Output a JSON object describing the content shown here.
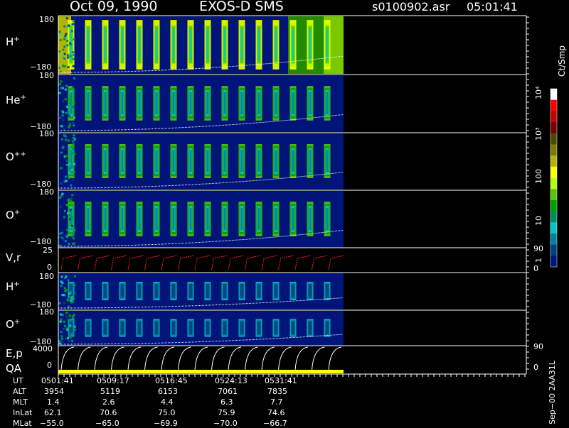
{
  "header": {
    "date": "Oct 09, 1990",
    "instrument": "EXOS-D SMS",
    "filename": "s0100902.asr",
    "time": "05:01:41"
  },
  "colorbar": {
    "unit": "Ct/Smp",
    "labels": [
      "10⁴",
      "10³",
      "100",
      "10",
      "1"
    ],
    "colors": [
      "#ffffff",
      "#ff0000",
      "#c80000",
      "#780000",
      "#4a4a00",
      "#7a7a00",
      "#b4b400",
      "#ffff00",
      "#b4ff00",
      "#5ac800",
      "#00a000",
      "#008c5a",
      "#00c8c8",
      "#0080a0",
      "#004080",
      "#00147a"
    ]
  },
  "chart_data": [
    {
      "type": "heatmap",
      "panel": "H+",
      "label": "H",
      "sup": "+",
      "ytick_top": "180",
      "ytick_bottom": "−180",
      "ylim": [
        -180,
        180
      ]
    },
    {
      "type": "heatmap",
      "panel": "He+",
      "label": "He",
      "sup": "+",
      "ytick_top": "180",
      "ytick_bottom": "−180",
      "ylim": [
        -180,
        180
      ]
    },
    {
      "type": "heatmap",
      "panel": "O++",
      "label": "O",
      "sup": "++",
      "ytick_top": "180",
      "ytick_bottom": "−180",
      "ylim": [
        -180,
        180
      ]
    },
    {
      "type": "heatmap",
      "panel": "O+",
      "label": "O",
      "sup": "+",
      "ytick_top": "180",
      "ytick_bottom": "−180",
      "ylim": [
        -180,
        180
      ]
    },
    {
      "type": "line",
      "panel": "V,r",
      "label": "V,r",
      "ytick_top": "25",
      "ytick_bottom": "0",
      "right_top": "90",
      "right_bottom": "0"
    },
    {
      "type": "heatmap",
      "panel": "H+ (2)",
      "label": "H",
      "sup": "+",
      "ytick_top": "180",
      "ytick_bottom": "−180",
      "ylim": [
        -180,
        180
      ]
    },
    {
      "type": "heatmap",
      "panel": "O+ (2)",
      "label": "O",
      "sup": "+",
      "ytick_top": "180",
      "ytick_bottom": "−180",
      "ylim": [
        -180,
        180
      ]
    },
    {
      "type": "line",
      "panel": "E,p",
      "label": "E,p",
      "label2": "QA",
      "ytick_top": "4000",
      "ytick_bottom": "0",
      "right_top": "90",
      "right_bottom": "0"
    }
  ],
  "footer": {
    "row_labels": [
      "UT",
      "ALT",
      "MLT",
      "InLat",
      "MLat"
    ],
    "columns": [
      [
        "0501:41",
        "3954",
        "1.4",
        "62.1",
        "−55.0"
      ],
      [
        "0509:17",
        "5119",
        "2.6",
        "70.6",
        "−65.0"
      ],
      [
        "0516:45",
        "6153",
        "4.4",
        "75.0",
        "−69.9"
      ],
      [
        "0524:13",
        "7061",
        "6.3",
        "75.9",
        "−70.0"
      ],
      [
        "0531:41",
        "7835",
        "7.7",
        "74.6",
        "−66.7"
      ]
    ],
    "side_text": "Sep−00  2AA31L"
  }
}
